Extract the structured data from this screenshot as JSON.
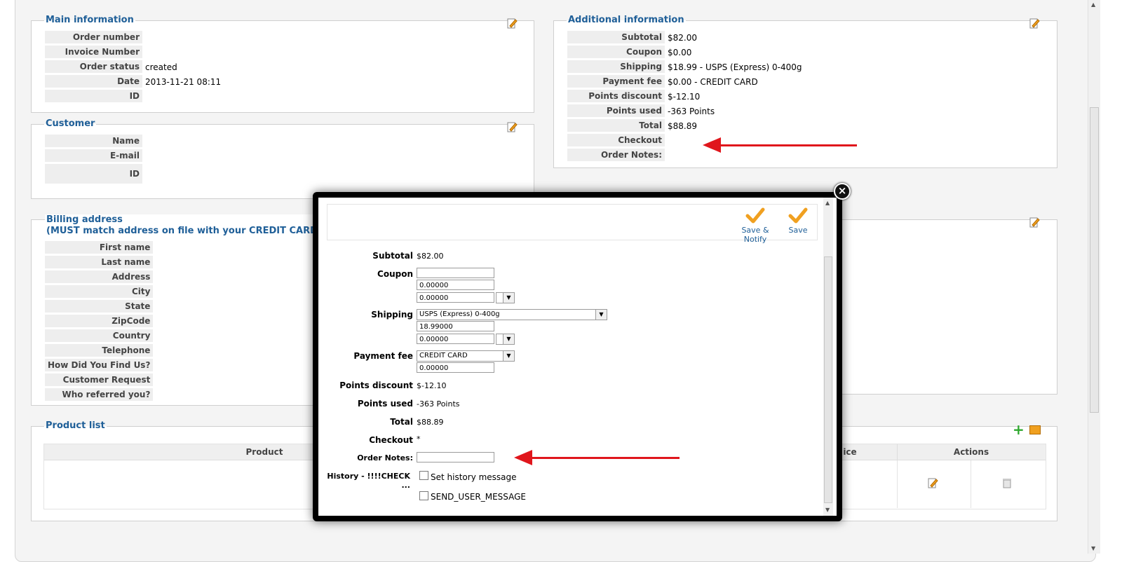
{
  "main_info": {
    "title": "Main information",
    "rows": [
      {
        "k": "Order number",
        "v": ""
      },
      {
        "k": "Invoice Number",
        "v": ""
      },
      {
        "k": "Order status",
        "v": "created"
      },
      {
        "k": "Date",
        "v": "2013-11-21 08:11"
      },
      {
        "k": "ID",
        "v": ""
      }
    ]
  },
  "customer": {
    "title": "Customer",
    "rows": [
      {
        "k": "Name",
        "v": ""
      },
      {
        "k": "E-mail",
        "v": ""
      },
      {
        "k": "ID",
        "v": ""
      }
    ]
  },
  "additional": {
    "title": "Additional information",
    "rows": [
      {
        "k": "Subtotal",
        "v": "$82.00"
      },
      {
        "k": "Coupon",
        "v": "$0.00"
      },
      {
        "k": "Shipping",
        "v": "$18.99 - USPS (Express) 0-400g"
      },
      {
        "k": "Payment fee",
        "v": "$0.00 - CREDIT CARD"
      },
      {
        "k": "Points discount",
        "v": "$-12.10"
      },
      {
        "k": "Points used",
        "v": "-363 Points"
      },
      {
        "k": "Total",
        "v": "$88.89"
      },
      {
        "k": "Checkout",
        "v": ""
      },
      {
        "k": "Order Notes:",
        "v": ""
      }
    ]
  },
  "billing": {
    "title_line1": "Billing address",
    "title_line2": "(MUST match address on file with your CREDIT CARD)",
    "rows": [
      {
        "k": "First name"
      },
      {
        "k": "Last name"
      },
      {
        "k": "Address"
      },
      {
        "k": "City"
      },
      {
        "k": "State"
      },
      {
        "k": "ZipCode"
      },
      {
        "k": "Country"
      },
      {
        "k": "Telephone"
      },
      {
        "k": "How Did You Find Us?"
      },
      {
        "k": "Customer Request"
      },
      {
        "k": "Who referred you?"
      }
    ]
  },
  "products": {
    "title": "Product list",
    "col_product": "Product",
    "col_price_partial": "ice",
    "col_actions": "Actions"
  },
  "modal": {
    "save_notify": "Save & Notify",
    "save": "Save",
    "subtotal_label": "Subtotal",
    "subtotal_value": "$82.00",
    "coupon_label": "Coupon",
    "coupon_code": "",
    "coupon_value": "0.00000",
    "coupon_tax": "0.00000",
    "shipping_label": "Shipping",
    "shipping_method": "USPS (Express) 0-400g",
    "shipping_value": "18.99000",
    "shipping_tax": "0.00000",
    "payment_label": "Payment fee",
    "payment_method": "CREDIT CARD",
    "payment_value": "0.00000",
    "points_discount_label": "Points discount",
    "points_discount_value": "$-12.10",
    "points_used_label": "Points used",
    "points_used_value": "-363 Points",
    "total_label": "Total",
    "total_value": "$88.89",
    "checkout_label": "Checkout",
    "checkout_value": "*",
    "notes_label": "Order Notes:",
    "notes_value": "",
    "history_label": "History - !!!!CHECK ...",
    "history_opt1": "Set history message",
    "history_opt2": "SEND_USER_MESSAGE"
  },
  "colors": {
    "legend": "#1f5f98",
    "arrow": "#e0161c",
    "accent_check": "#f0a020"
  }
}
